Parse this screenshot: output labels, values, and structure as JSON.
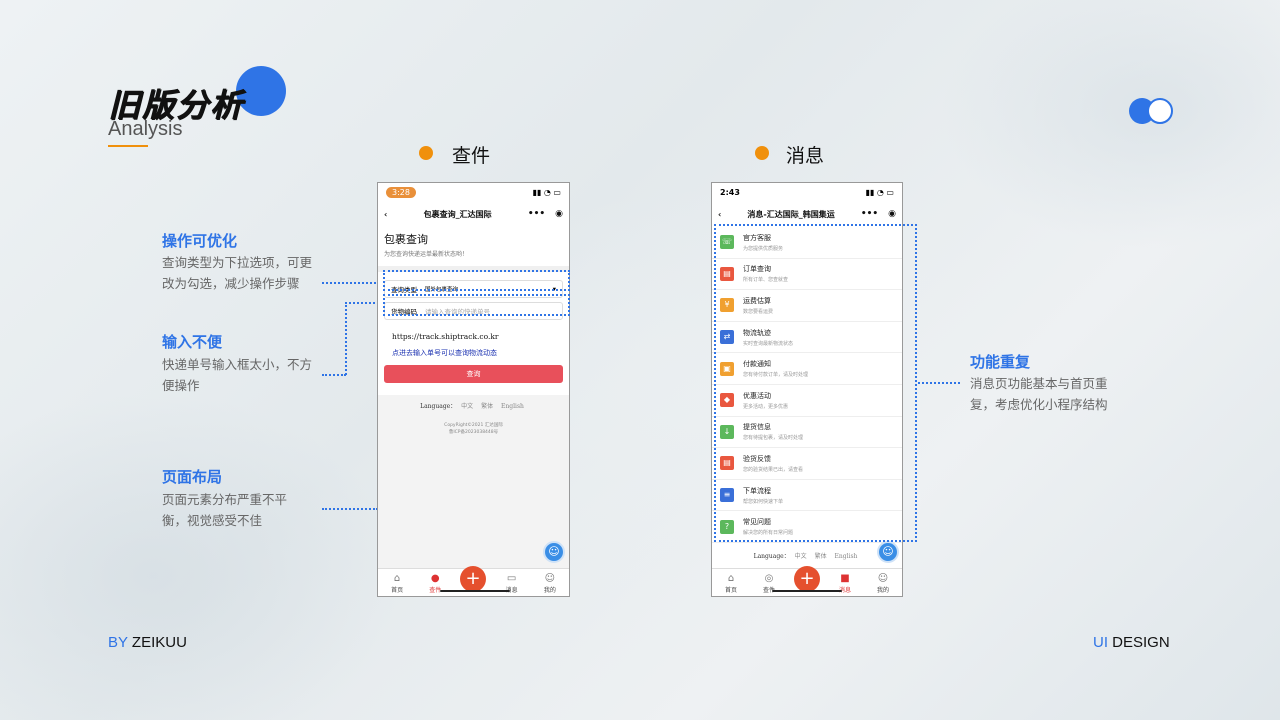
{
  "title": {
    "main": "旧版分析",
    "sub": "Analysis"
  },
  "sections": {
    "left": "查件",
    "right": "消息"
  },
  "annotations": [
    {
      "title": "操作可优化",
      "text": "查询类型为下拉选项，可更改为勾选，减少操作步骤"
    },
    {
      "title": "输入不便",
      "text": "快递单号输入框太小，不方便操作"
    },
    {
      "title": "页面布局",
      "text": "页面元素分布严重不平衡，视觉感受不佳"
    },
    {
      "title": "功能重复",
      "text": "消息页功能基本与首页重复，考虑优化小程序结构"
    }
  ],
  "phone1": {
    "time": "3:28",
    "nav_title": "包裹查询_汇达国际",
    "heading": "包裹查询",
    "subheading": "为您查询快递运单最新状态哟！",
    "type_label": "查询类型",
    "type_value": "国外包裹查询",
    "code_label": "货物编码",
    "code_placeholder": "请输入查询的快递单号",
    "url": "https://track.shiptrack.co.kr",
    "hint": "点进去输入单号可以查询物流动态",
    "button": "查询",
    "lang_label": "Language：",
    "lang_opts": [
      "中文",
      "繁体",
      "English"
    ],
    "copyright": "CopyRight©2021 汇达国际",
    "icp": "鲁ICP备2023038448号",
    "tabs": [
      "首页",
      "查件",
      "消息",
      "我的"
    ]
  },
  "phone2": {
    "time": "2:43",
    "nav_title": "消息-汇达国际_韩国集运",
    "items": [
      {
        "title": "官方客服",
        "desc": "为您提供优质服务",
        "color": "#5cb85c",
        "icon": "☏"
      },
      {
        "title": "订单查询",
        "desc": "所有订单、您查就查",
        "color": "#e9573f",
        "icon": "▤"
      },
      {
        "title": "运费估算",
        "desc": "数您要看运费",
        "color": "#f0a030",
        "icon": "¥"
      },
      {
        "title": "物流轨迹",
        "desc": "实时查询最新物流状态",
        "color": "#3a6fd8",
        "icon": "⇄"
      },
      {
        "title": "付款通知",
        "desc": "您有待付款订单，请及时处理",
        "color": "#f0a030",
        "icon": "▣"
      },
      {
        "title": "优惠活动",
        "desc": "更多活动，更多优惠",
        "color": "#e9573f",
        "icon": "◆"
      },
      {
        "title": "提货信息",
        "desc": "您有待提包裹，请及时处理",
        "color": "#5cb85c",
        "icon": "↓"
      },
      {
        "title": "验货反馈",
        "desc": "您的验货结果已出，请查看",
        "color": "#e9573f",
        "icon": "▤"
      },
      {
        "title": "下单流程",
        "desc": "帮您如何快速下单",
        "color": "#3a6fd8",
        "icon": "≡"
      },
      {
        "title": "常见问题",
        "desc": "解决您的所有日常问题",
        "color": "#5cb85c",
        "icon": "?"
      }
    ],
    "lang_label": "Language：",
    "lang_opts": [
      "中文",
      "繁体",
      "English"
    ],
    "tabs": [
      "首页",
      "查件",
      "消息",
      "我的"
    ]
  },
  "footer": {
    "by": "BY",
    "author": "ZEIKUU",
    "ui": "UI",
    "design": "DESIGN"
  }
}
